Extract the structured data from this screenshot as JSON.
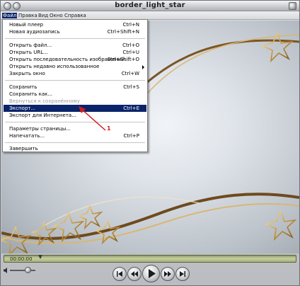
{
  "window": {
    "title": "border_light_star"
  },
  "menubar": {
    "items": [
      "Файл",
      "Правка",
      "Вид",
      "Окно",
      "Справка"
    ]
  },
  "file_menu": {
    "items": [
      {
        "label": "Новый плеер",
        "shortcut": "Ctrl+N",
        "state": "normal"
      },
      {
        "label": "Новая аудиозапись",
        "shortcut": "Ctrl+Shift+N",
        "state": "normal"
      },
      {
        "label": "Открыть файл...",
        "shortcut": "Ctrl+O",
        "state": "normal"
      },
      {
        "label": "Открыть URL...",
        "shortcut": "Ctrl+U",
        "state": "normal"
      },
      {
        "label": "Открыть последовательность изображений...",
        "shortcut": "Ctrl+Shift+O",
        "state": "normal"
      },
      {
        "label": "Открыть недавно использованное",
        "shortcut": "",
        "state": "submenu"
      },
      {
        "label": "Закрыть окно",
        "shortcut": "Ctrl+W",
        "state": "normal"
      },
      {
        "label": "Сохранить",
        "shortcut": "Ctrl+S",
        "state": "normal"
      },
      {
        "label": "Сохранить как...",
        "shortcut": "",
        "state": "normal"
      },
      {
        "label": "Вернуться к сохранённому",
        "shortcut": "",
        "state": "disabled"
      },
      {
        "label": "Экспорт...",
        "shortcut": "Ctrl+E",
        "state": "highlighted"
      },
      {
        "label": "Экспорт для Интернета...",
        "shortcut": "",
        "state": "normal"
      },
      {
        "label": "Параметры страницы...",
        "shortcut": "",
        "state": "normal"
      },
      {
        "label": "Напечатать...",
        "shortcut": "Ctrl+P",
        "state": "normal"
      },
      {
        "label": "Завершить",
        "shortcut": "",
        "state": "normal"
      }
    ]
  },
  "annotation": {
    "label": "1"
  },
  "player": {
    "time": "00:00:00"
  },
  "colors": {
    "menu_highlight": "#0a246a",
    "annotation": "#d21e1e",
    "seekbar": "#b7c28d"
  }
}
